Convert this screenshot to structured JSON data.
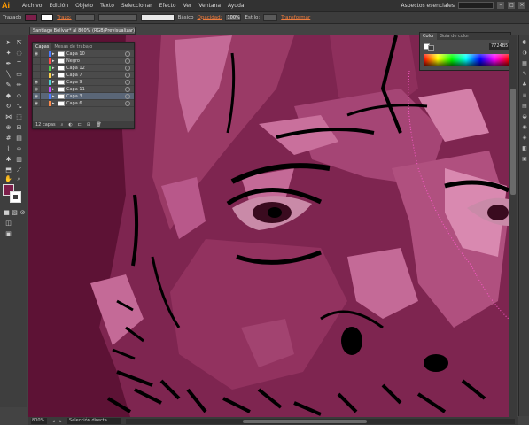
{
  "app": {
    "logo": "Ai"
  },
  "menu": {
    "items": [
      "Archivo",
      "Edición",
      "Objeto",
      "Texto",
      "Seleccionar",
      "Efecto",
      "Ver",
      "Ventana",
      "Ayuda"
    ],
    "workspace": "Aspectos esenciales"
  },
  "control": {
    "selection_label": "Trazado",
    "stroke_label": "Trazo:",
    "brush_label": "Básico",
    "opacity_label": "Opacidad:",
    "opacity_value": "100%",
    "style_label": "Estilo:",
    "transform_label": "Transformar",
    "fill_color": "#7c1f4a"
  },
  "document": {
    "tab_title": "Santiago Bolívar* al 800% (RGB/Previsualizar)"
  },
  "layers_panel": {
    "tab_active": "Capas",
    "tab_other": "Mesas de trabajo",
    "rows": [
      {
        "name": "Capa 10",
        "color": "#4a7bff",
        "selected": false
      },
      {
        "name": "Negro",
        "color": "#ff4a4a",
        "selected": false
      },
      {
        "name": "Capa 12",
        "color": "#4ad24a",
        "selected": false
      },
      {
        "name": "Capa 7",
        "color": "#ffd24a",
        "selected": false
      },
      {
        "name": "Capa 9",
        "color": "#4ad2d2",
        "selected": false
      },
      {
        "name": "Capa 11",
        "color": "#c84aff",
        "selected": false
      },
      {
        "name": "Capa 3",
        "color": "#4a7bff",
        "selected": true
      },
      {
        "name": "Capa 6",
        "color": "#ff8a4a",
        "selected": false
      }
    ],
    "footer_count": "12 capas"
  },
  "color_panel": {
    "tab_active": "Color",
    "tab_other": "Guía de color",
    "hex_value": "7724B5"
  },
  "status": {
    "zoom": "800%",
    "tool_status": "Selección directa"
  }
}
